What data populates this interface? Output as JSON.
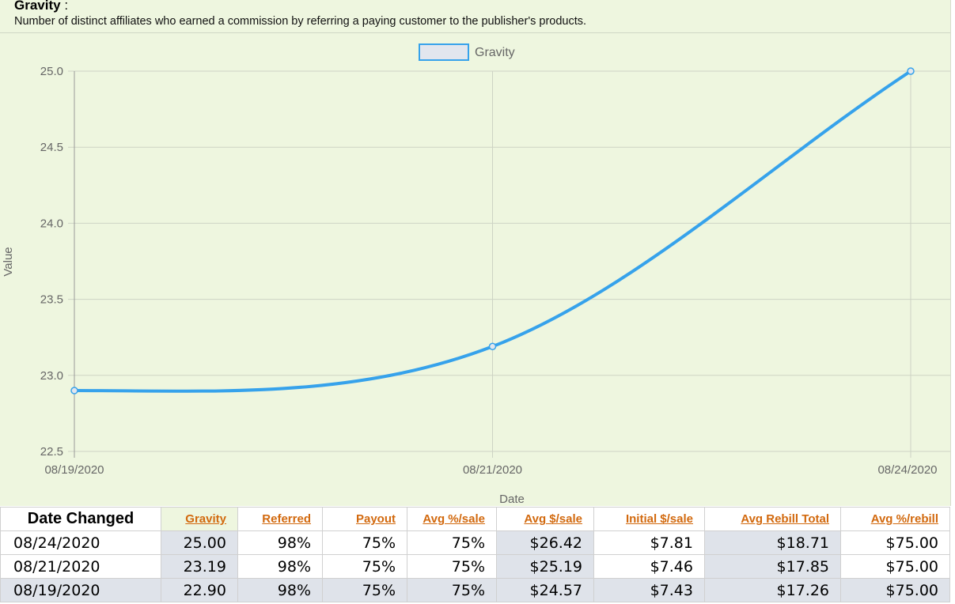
{
  "header": {
    "title": "Gravity",
    "title_suffix": ":",
    "description": "Number of distinct affiliates who earned a commission by referring a paying customer to the publisher's products."
  },
  "chart_data": {
    "type": "line",
    "title": "",
    "xlabel": "Date",
    "ylabel": "Value",
    "legend": "top-center",
    "grid": true,
    "categories": [
      "08/19/2020",
      "08/21/2020",
      "08/24/2020"
    ],
    "series": [
      {
        "name": "Gravity",
        "values": [
          22.9,
          23.19,
          25.0
        ],
        "color": "#36a2eb"
      }
    ],
    "ylim": [
      22.5,
      25.0
    ],
    "yticks": [
      "25.0",
      "24.5",
      "24.0",
      "23.5",
      "23.0",
      "22.5"
    ]
  },
  "table": {
    "headers": [
      "Date Changed",
      "Gravity",
      "Referred",
      "Payout",
      "Avg %/sale",
      "Avg $/sale",
      "Initial $/sale",
      "Avg Rebill Total",
      "Avg %/rebill"
    ],
    "rows": [
      [
        "08/24/2020",
        "25.00",
        "98%",
        "75%",
        "75%",
        "$26.42",
        "$7.81",
        "$18.71",
        "$75.00"
      ],
      [
        "08/21/2020",
        "23.19",
        "98%",
        "75%",
        "75%",
        "$25.19",
        "$7.46",
        "$17.85",
        "$75.00"
      ],
      [
        "08/19/2020",
        "22.90",
        "98%",
        "75%",
        "75%",
        "$24.57",
        "$7.43",
        "$17.26",
        "$75.00"
      ]
    ]
  }
}
